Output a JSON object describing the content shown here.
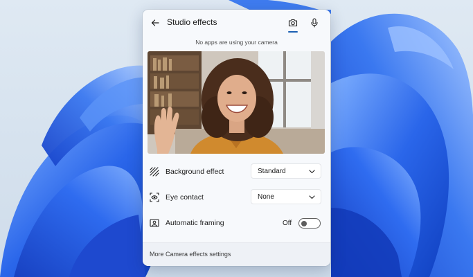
{
  "panel": {
    "title": "Studio effects",
    "tabs": [
      {
        "icon": "camera-icon",
        "selected": true
      },
      {
        "icon": "microphone-icon",
        "selected": false
      }
    ],
    "status_text": "No apps are using your camera"
  },
  "settings": {
    "background_effect": {
      "label": "Background effect",
      "value": "Standard",
      "icon": "background-effect-icon"
    },
    "eye_contact": {
      "label": "Eye contact",
      "value": "None",
      "icon": "eye-contact-icon"
    },
    "automatic_framing": {
      "label": "Automatic framing",
      "state_label": "Off",
      "on": false,
      "icon": "framing-icon"
    }
  },
  "footer": {
    "link_label": "More Camera effects settings"
  },
  "colors": {
    "accent": "#1b5fb3",
    "panel_bg": "#f7f9fc",
    "footer_bg": "#eef1f6",
    "wallpaper_blue": "#1f5fe0"
  }
}
